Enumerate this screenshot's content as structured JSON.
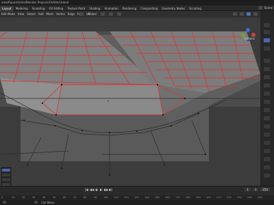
{
  "window": {
    "title": "ome/Repositories/Blender Projects/Untitled.blend"
  },
  "workspace": {
    "tabs": [
      "Layout",
      "Modeling",
      "Sculpting",
      "UV Editing",
      "Texture Paint",
      "Shading",
      "Animation",
      "Rendering",
      "Compositing",
      "Geometry Nodes",
      "Scripting"
    ],
    "active_tab": "Layout",
    "scene_label": "Scene"
  },
  "viewport_header": {
    "menus": [
      "Edit Mode",
      "View",
      "Select",
      "Add",
      "Mesh",
      "Vertex",
      "Edge",
      "Face",
      "UV"
    ],
    "transform_label": "Global",
    "viewport_shading_label": "Options"
  },
  "operator_panel": {
    "rows": [
      "",
      "",
      "",
      "",
      ""
    ]
  },
  "timeline": {
    "playback_controls": [
      "|◀",
      "◀◀",
      "◀",
      "▶",
      "▶▶",
      "▶|"
    ],
    "current_frame": "1",
    "start_frame": "1",
    "end_frame": "250"
  },
  "ruler": {
    "ticks": [
      "0",
      "10",
      "20",
      "30",
      "40",
      "50",
      "60",
      "70",
      "80",
      "90",
      "100",
      "110",
      "120",
      "130",
      "140",
      "150",
      "160",
      "170",
      "180",
      "190",
      "200",
      "210",
      "220",
      "230",
      "240",
      "250"
    ]
  },
  "status": {
    "message": "Call Menu"
  }
}
